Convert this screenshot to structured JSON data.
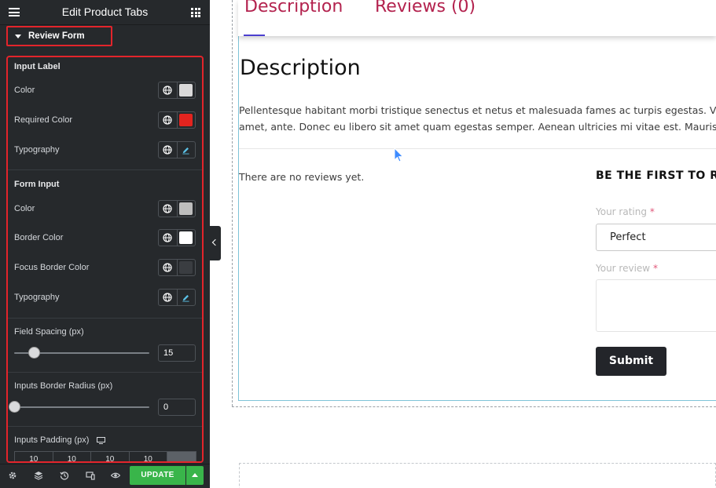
{
  "panel": {
    "title": "Edit Product Tabs",
    "section": "Review Form",
    "input_label_group": {
      "title": "Input Label",
      "color_label": "Color",
      "color_value": "#d9d9d9",
      "required_color_label": "Required Color",
      "required_color_value": "#e3241f",
      "typography_label": "Typography"
    },
    "form_input_group": {
      "title": "Form Input",
      "color_label": "Color",
      "color_value": "#bdbdbd",
      "border_color_label": "Border Color",
      "border_color_value": "#ffffff",
      "focus_border_color_label": "Focus Border Color",
      "focus_border_color_value": "#3a3d41",
      "typography_label": "Typography"
    },
    "field_spacing": {
      "label": "Field Spacing (px)",
      "value": "15",
      "fraction": 0.15
    },
    "border_radius": {
      "label": "Inputs Border Radius (px)",
      "value": "0",
      "fraction": 0
    },
    "padding": {
      "label": "Inputs Padding (px)",
      "values": [
        "10",
        "10",
        "10",
        "10"
      ]
    },
    "footer": {
      "update_label": "UPDATE"
    }
  },
  "preview": {
    "tabs": [
      "Description",
      "Reviews (0)"
    ],
    "heading": "Description",
    "paragraph_line1": "Pellentesque habitant morbi tristique senectus et netus et malesuada fames ac turpis egestas. Ve",
    "paragraph_line2": "amet, ante. Donec eu libero sit amet quam egestas semper. Aenean ultricies mi vitae est. Mauris",
    "no_reviews": "There are no reviews yet.",
    "first_review": "BE THE FIRST TO RE",
    "rating_label": "Your rating",
    "rating_value": "Perfect",
    "review_label": "Your review",
    "required_mark": "*",
    "submit_label": "Submit",
    "accent_color": "#b3224e"
  }
}
